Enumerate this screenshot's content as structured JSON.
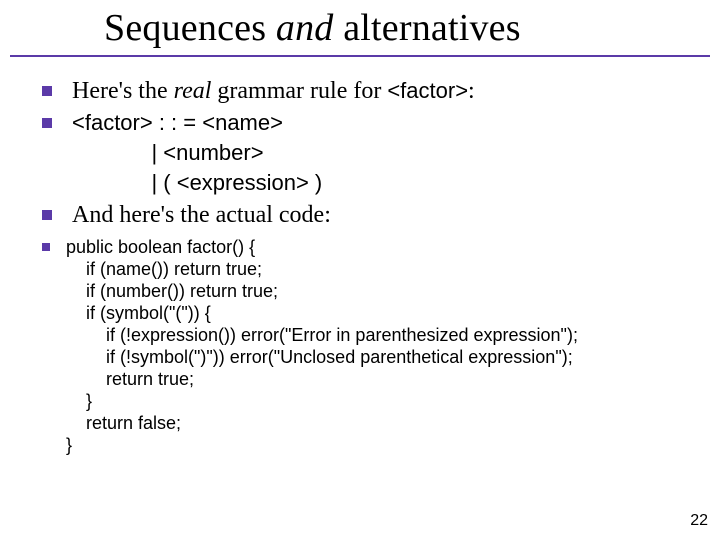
{
  "title": {
    "pre": "Sequences ",
    "ital": "and",
    "post": " alternatives"
  },
  "bullets": {
    "b1": {
      "pre": "Here's the ",
      "ital": "real",
      "mid": " grammar rule for ",
      "code": "<factor>",
      "post": ":"
    },
    "b2_grammar": "<factor> : : = <name>\n             | <number>\n             | ( <expression> )",
    "b3": "And here's the actual code:",
    "b4_code": "public boolean factor() {\n    if (name()) return true;\n    if (number()) return true;\n    if (symbol(\"(\")) {\n        if (!expression()) error(\"Error in parenthesized expression\");\n        if (!symbol(\")\")) error(\"Unclosed parenthetical expression\");\n        return true;\n    }\n    return false;\n}"
  },
  "page_number": "22"
}
